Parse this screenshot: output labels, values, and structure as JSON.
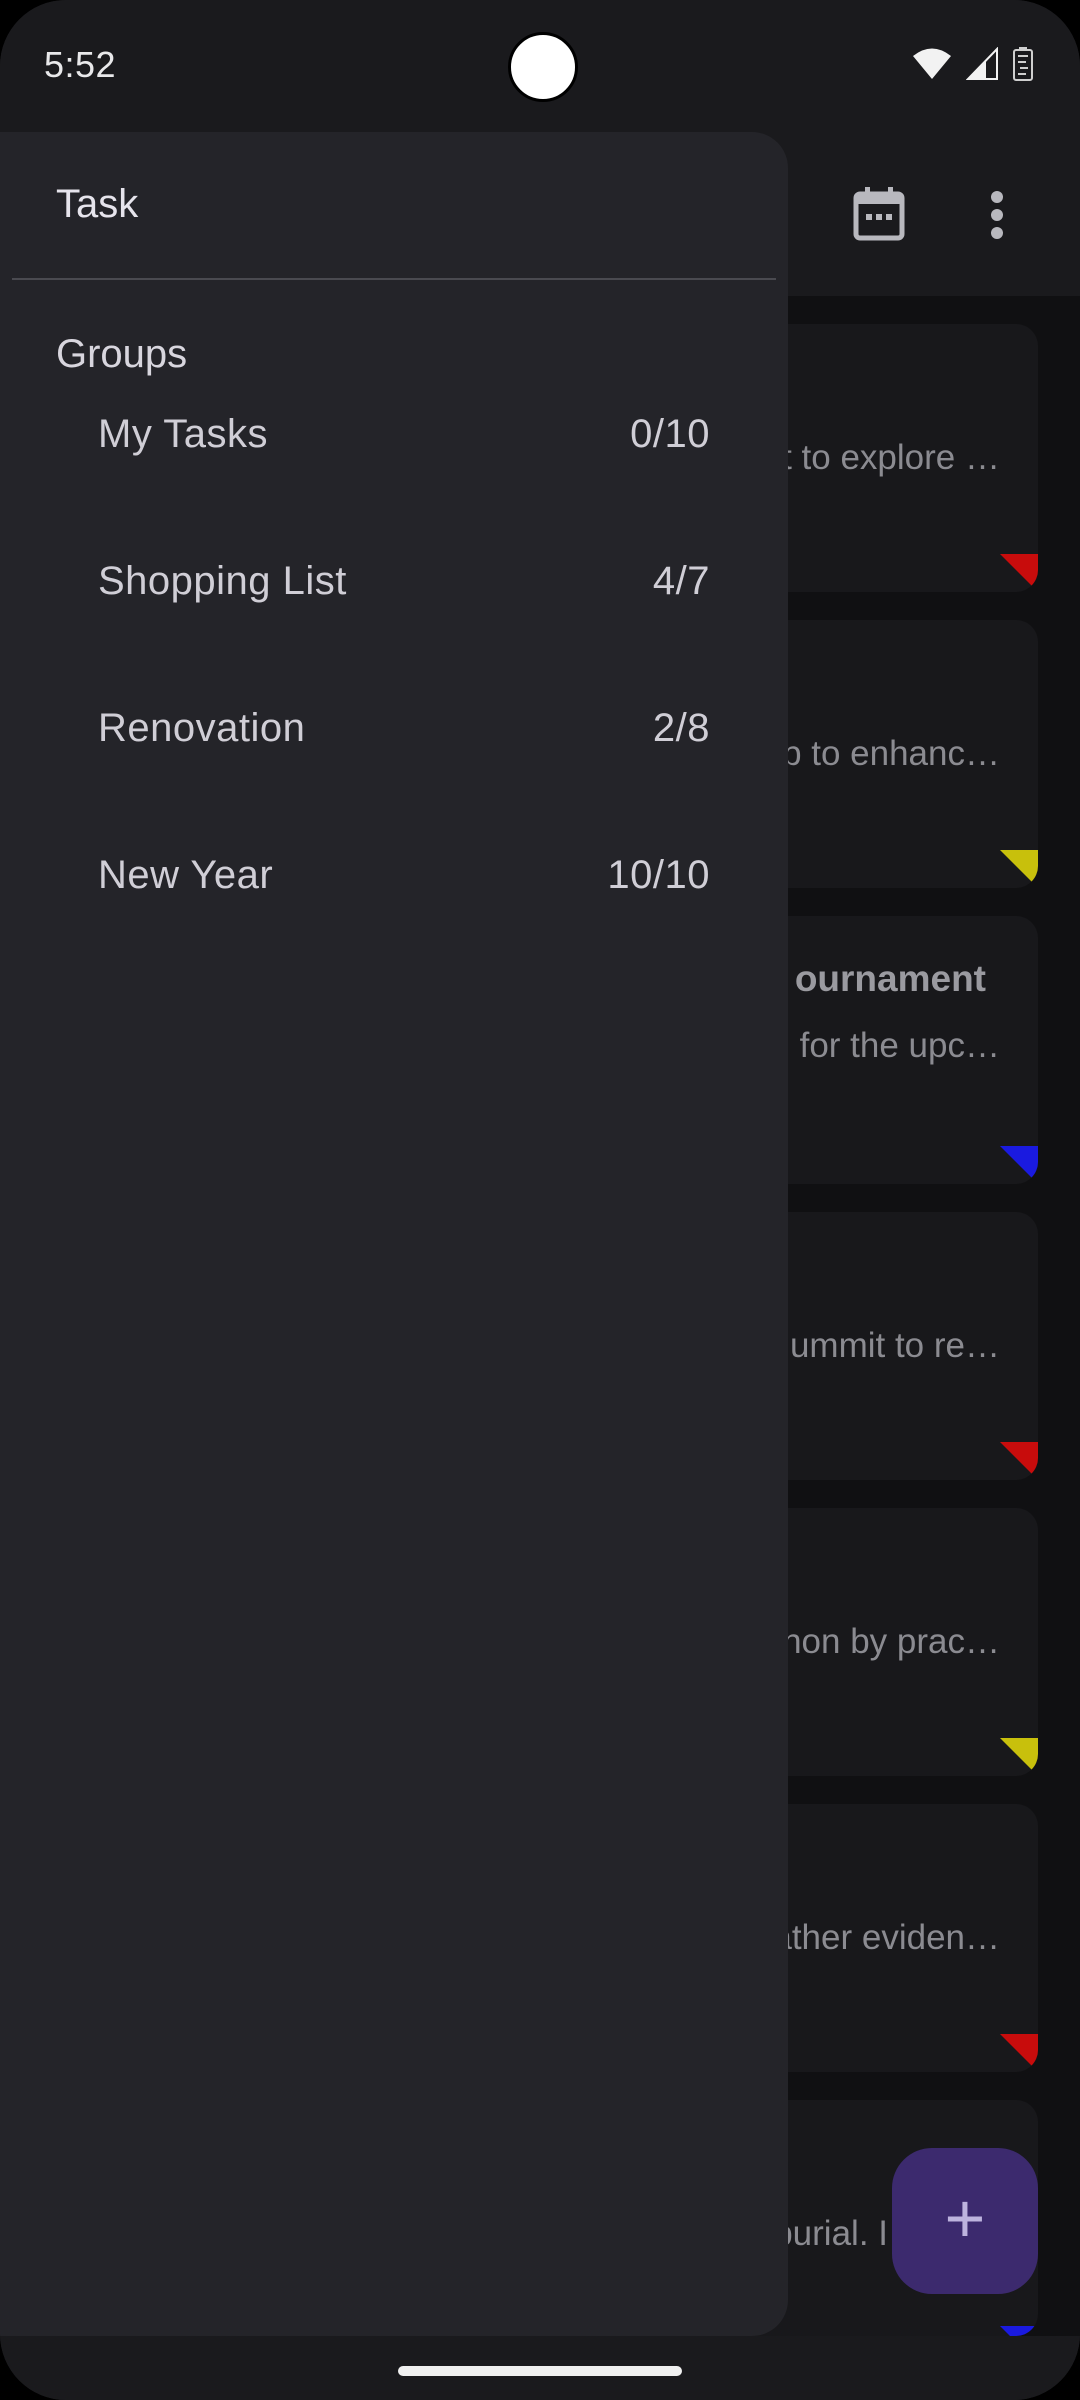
{
  "status_bar": {
    "time": "5:52"
  },
  "background_app": {
    "cards": [
      {
        "title": "",
        "description": "t to explore …",
        "priority_color": "#c80c0c"
      },
      {
        "title": "",
        "description": "p to enhanc…",
        "priority_color": "#c8c00c"
      },
      {
        "title": "ournament",
        "description": "for the upc…",
        "priority_color": "#1a1ae0"
      },
      {
        "title": "",
        "description": "ummit to re…",
        "priority_color": "#c80c0c"
      },
      {
        "title": "",
        "description": "hon by prac…",
        "priority_color": "#c8c00c"
      },
      {
        "title": "",
        "description": "ather eviden…",
        "priority_color": "#c80c0c"
      },
      {
        "title": "",
        "description": "burial. I",
        "priority_color": "#1a1ae0"
      }
    ],
    "fab_icon": "plus-icon",
    "fab_symbol": "+"
  },
  "drawer": {
    "title": "Task",
    "groups_label": "Groups",
    "groups": [
      {
        "name": "My Tasks",
        "count": "0/10"
      },
      {
        "name": "Shopping List",
        "count": "4/7"
      },
      {
        "name": "Renovation",
        "count": "2/8"
      },
      {
        "name": "New Year",
        "count": "10/10"
      }
    ]
  }
}
